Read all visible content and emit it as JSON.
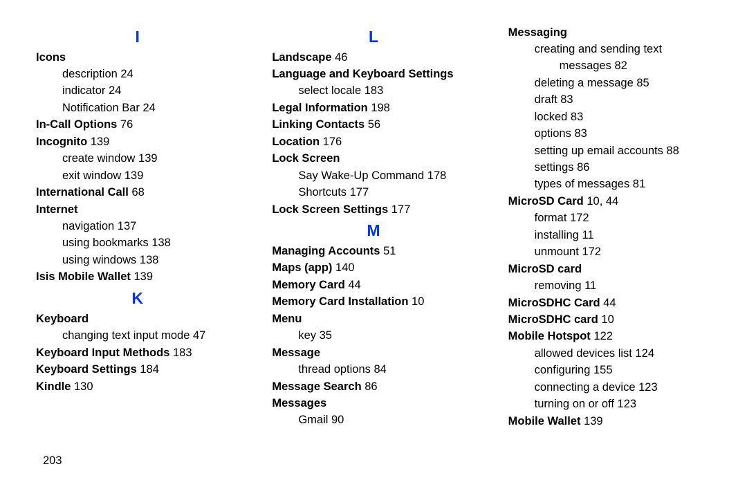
{
  "page_number": "203",
  "columns": [
    [
      {
        "kind": "letter",
        "text": "I"
      },
      {
        "kind": "head",
        "text": "Icons"
      },
      {
        "kind": "sub",
        "text": "description 24"
      },
      {
        "kind": "sub",
        "text": "indicator 24"
      },
      {
        "kind": "sub",
        "text": "Notification Bar 24"
      },
      {
        "kind": "head",
        "text": "In-Call Options",
        "page": "76"
      },
      {
        "kind": "head",
        "text": "Incognito",
        "page": "139"
      },
      {
        "kind": "sub",
        "text": "create window 139"
      },
      {
        "kind": "sub",
        "text": "exit window 139"
      },
      {
        "kind": "head",
        "text": "International Call",
        "page": "68"
      },
      {
        "kind": "head",
        "text": "Internet"
      },
      {
        "kind": "sub",
        "text": "navigation 137"
      },
      {
        "kind": "sub",
        "text": "using bookmarks 138"
      },
      {
        "kind": "sub",
        "text": "using windows 138"
      },
      {
        "kind": "head",
        "text": "Isis Mobile Wallet",
        "page": "139"
      },
      {
        "kind": "letter",
        "text": "K"
      },
      {
        "kind": "head",
        "text": "Keyboard"
      },
      {
        "kind": "sub",
        "text": "changing text input mode 47"
      },
      {
        "kind": "head",
        "text": "Keyboard Input Methods",
        "page": "183"
      },
      {
        "kind": "head",
        "text": "Keyboard Settings",
        "page": "184"
      },
      {
        "kind": "head",
        "text": "Kindle",
        "page": "130"
      }
    ],
    [
      {
        "kind": "letter",
        "text": "L"
      },
      {
        "kind": "head",
        "text": "Landscape",
        "page": "46"
      },
      {
        "kind": "head",
        "text": "Language and Keyboard Settings"
      },
      {
        "kind": "sub",
        "text": "select locale 183"
      },
      {
        "kind": "head",
        "text": "Legal Information",
        "page": "198"
      },
      {
        "kind": "head",
        "text": "Linking Contacts",
        "page": "56"
      },
      {
        "kind": "head",
        "text": "Location",
        "page": "176"
      },
      {
        "kind": "head",
        "text": "Lock Screen"
      },
      {
        "kind": "sub",
        "text": "Say Wake-Up Command 178"
      },
      {
        "kind": "sub",
        "text": "Shortcuts 177"
      },
      {
        "kind": "head",
        "text": "Lock Screen Settings",
        "page": "177"
      },
      {
        "kind": "letter",
        "text": "M"
      },
      {
        "kind": "head",
        "text": "Managing Accounts",
        "page": "51"
      },
      {
        "kind": "head",
        "text": "Maps (app)",
        "page": "140"
      },
      {
        "kind": "head",
        "text": "Memory Card",
        "page": "44"
      },
      {
        "kind": "head",
        "text": "Memory Card Installation",
        "page": "10"
      },
      {
        "kind": "head",
        "text": "Menu"
      },
      {
        "kind": "sub",
        "text": "key 35"
      },
      {
        "kind": "head",
        "text": "Message"
      },
      {
        "kind": "sub",
        "text": "thread options 84"
      },
      {
        "kind": "head",
        "text": "Message Search",
        "page": "86"
      },
      {
        "kind": "head",
        "text": "Messages"
      },
      {
        "kind": "sub",
        "text": "Gmail 90"
      }
    ],
    [
      {
        "kind": "head",
        "text": "Messaging"
      },
      {
        "kind": "sub",
        "text": "creating and sending text"
      },
      {
        "kind": "sub2",
        "text": "messages 82"
      },
      {
        "kind": "sub",
        "text": "deleting a message 85"
      },
      {
        "kind": "sub",
        "text": "draft 83"
      },
      {
        "kind": "sub",
        "text": "locked 83"
      },
      {
        "kind": "sub",
        "text": "options 83"
      },
      {
        "kind": "sub",
        "text": "setting up email accounts 88"
      },
      {
        "kind": "sub",
        "text": "settings 86"
      },
      {
        "kind": "sub",
        "text": "types of messages 81"
      },
      {
        "kind": "head",
        "text": "MicroSD Card",
        "page": "10, 44"
      },
      {
        "kind": "sub",
        "text": "format 172"
      },
      {
        "kind": "sub",
        "text": "installing 11"
      },
      {
        "kind": "sub",
        "text": "unmount 172"
      },
      {
        "kind": "head",
        "text": "MicroSD card"
      },
      {
        "kind": "sub",
        "text": "removing 11"
      },
      {
        "kind": "head",
        "text": "MicroSDHC Card",
        "page": "44"
      },
      {
        "kind": "head",
        "text": "MicroSDHC card",
        "page": "10"
      },
      {
        "kind": "head",
        "text": "Mobile Hotspot",
        "page": "122"
      },
      {
        "kind": "sub",
        "text": "allowed devices list 124"
      },
      {
        "kind": "sub",
        "text": "configuring 155"
      },
      {
        "kind": "sub",
        "text": "connecting a device 123"
      },
      {
        "kind": "sub",
        "text": "turning on or off 123"
      },
      {
        "kind": "head",
        "text": "Mobile Wallet",
        "page": "139"
      }
    ]
  ]
}
